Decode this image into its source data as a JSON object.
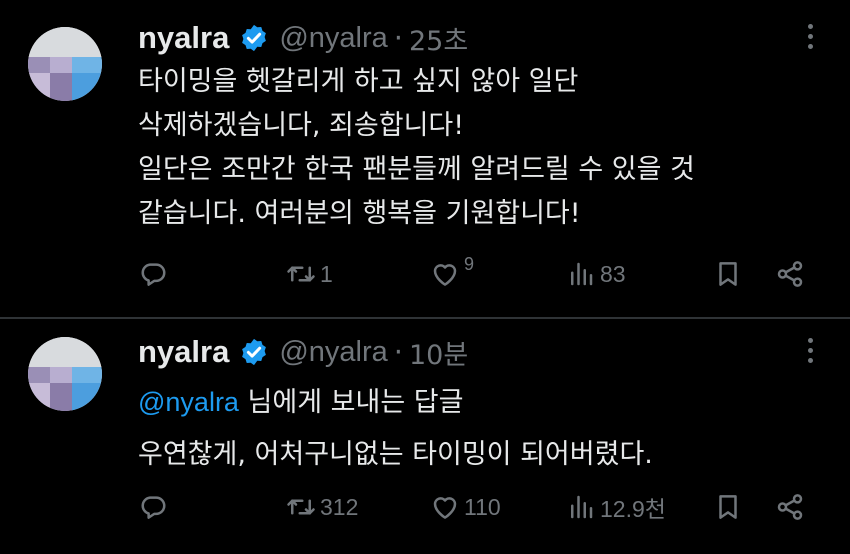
{
  "colors": {
    "background": "#000000",
    "text": "#e7e9ea",
    "muted": "#71767b",
    "accent": "#1d9bf0",
    "divider": "#2f3336"
  },
  "tweets": [
    {
      "display_name": "nyalra",
      "handle": "@nyalra",
      "separator": "·",
      "time": "25초",
      "verified": true,
      "text_lines": [
        "타이밍을 헷갈리게 하고 싶지 않아 일단",
        "삭제하겠습니다, 죄송합니다!",
        "일단은 조만간 한국 팬분들께 알려드릴 수 있을 것",
        "같습니다. 여러분의 행복을 기원합니다!"
      ],
      "actions": {
        "reply_icon": "reply-icon",
        "retweet_icon": "retweet-icon",
        "retweet_count": "1",
        "like_icon": "heart-icon",
        "like_count": "9",
        "views_icon": "bar-chart-icon",
        "views_count": "83",
        "bookmark_icon": "bookmark-icon",
        "share_icon": "share-icon"
      }
    },
    {
      "display_name": "nyalra",
      "handle": "@nyalra",
      "separator": "·",
      "time": "10분",
      "verified": true,
      "reply_mention": "@nyalra",
      "reply_suffix": " 님에게 보내는 답글",
      "text_lines": [
        "우연찮게, 어처구니없는 타이밍이 되어버렸다."
      ],
      "actions": {
        "reply_icon": "reply-icon",
        "retweet_icon": "retweet-icon",
        "retweet_count": "312",
        "like_icon": "heart-icon",
        "like_count": "110",
        "views_icon": "bar-chart-icon",
        "views_count": "12.9천",
        "bookmark_icon": "bookmark-icon",
        "share_icon": "share-icon"
      }
    }
  ]
}
